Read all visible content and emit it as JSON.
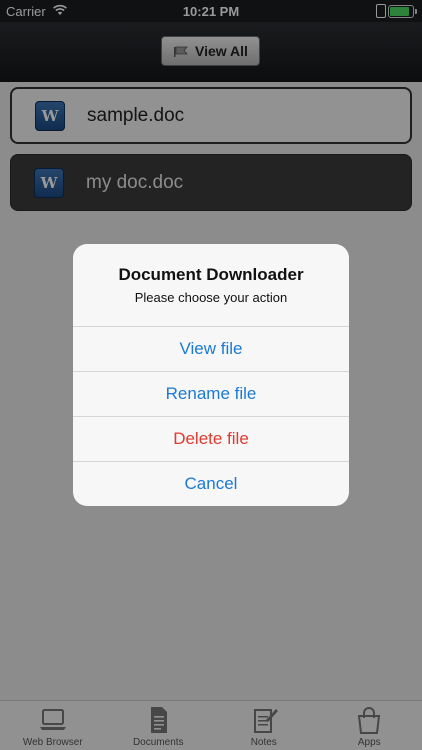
{
  "status_bar": {
    "carrier": "Carrier",
    "time": "10:21 PM",
    "battery_level_pct": 95
  },
  "nav_bar": {
    "view_all_label": "View All"
  },
  "documents": [
    {
      "name": "sample.doc",
      "icon": "word-doc-icon",
      "icon_letter": "W"
    },
    {
      "name": "my doc.doc",
      "icon": "word-doc-icon",
      "icon_letter": "W"
    }
  ],
  "dialog": {
    "title": "Document Downloader",
    "message": "Please choose your action",
    "actions": [
      {
        "label": "View file",
        "style": "default"
      },
      {
        "label": "Rename file",
        "style": "default"
      },
      {
        "label": "Delete file",
        "style": "destructive"
      },
      {
        "label": "Cancel",
        "style": "cancel"
      }
    ],
    "colors": {
      "action": "#1a7ad6",
      "destructive": "#e03a2f"
    }
  },
  "tab_bar": {
    "tabs": [
      {
        "label": "Web Browser",
        "icon": "laptop-icon"
      },
      {
        "label": "Documents",
        "icon": "document-icon"
      },
      {
        "label": "Notes",
        "icon": "notepad-icon"
      },
      {
        "label": "Apps",
        "icon": "shopping-bag-icon"
      }
    ]
  }
}
